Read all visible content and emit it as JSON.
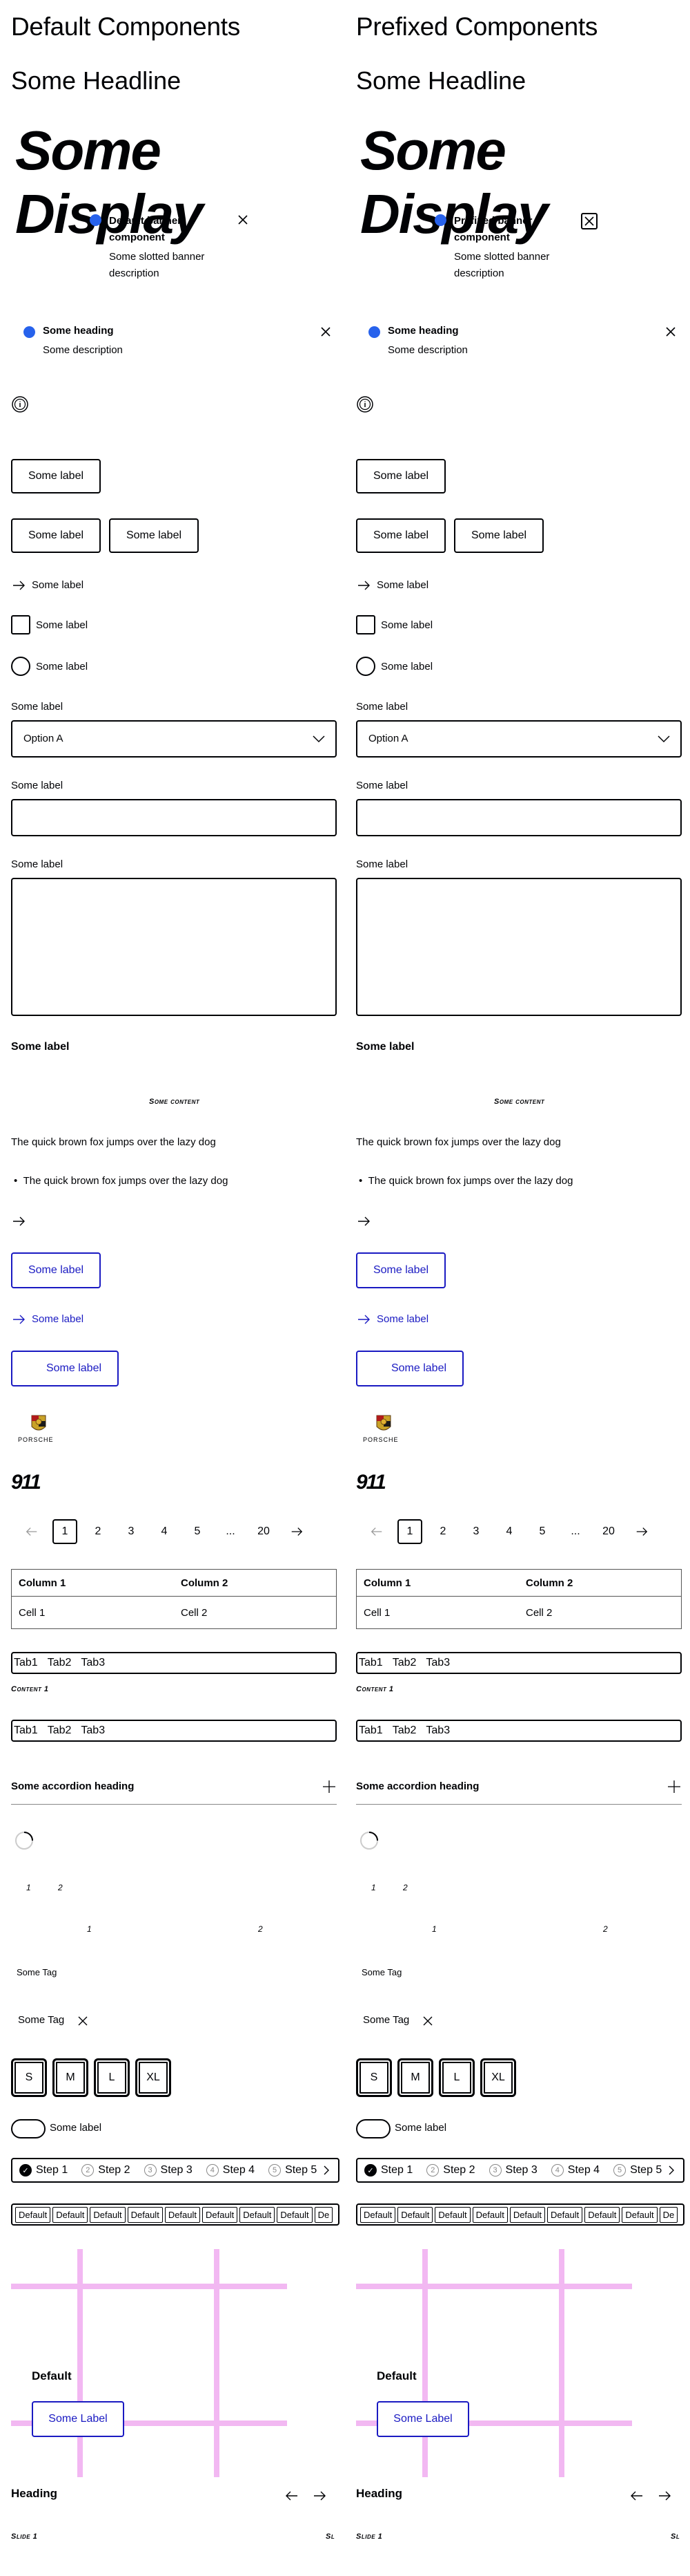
{
  "left": {
    "title": "Default Components",
    "headline": "Some Headline",
    "display": "Some Display",
    "banner": {
      "title": "Default banner component",
      "description": "Some slotted banner description"
    },
    "inline_notification": {
      "heading": "Some heading",
      "description": "Some description"
    },
    "button_label": "Some label",
    "button_group": [
      "Some label",
      "Some label"
    ],
    "link_pure_label": "Some label",
    "checkbox_label": "Some label",
    "radio_label": "Some label",
    "select": {
      "label": "Some label",
      "value": "Option A"
    },
    "text_field_label": "Some label",
    "textarea_label": "Some label",
    "text_heading": "Some label",
    "small_caps": "Some content",
    "text": "The quick brown fox jumps over the lazy dog",
    "list_item": "The quick brown fox jumps over the lazy dog",
    "link_label": "Some label",
    "link_pure_blue": "Some label",
    "link_social": "Some label",
    "crest_text": "PORSCHE",
    "model_signature": "911",
    "pagination": [
      "1",
      "2",
      "3",
      "4",
      "5",
      "...",
      "20"
    ],
    "table": {
      "headers": [
        "Column 1",
        "Column 2"
      ],
      "rows": [
        [
          "Cell 1",
          "Cell 2"
        ]
      ]
    },
    "tabs": [
      "Tab1",
      "Tab2",
      "Tab3"
    ],
    "tab_content": "Content 1",
    "tabs_bar": [
      "Tab1",
      "Tab2",
      "Tab3"
    ],
    "accordion_heading": "Some accordion heading",
    "grid_small": [
      "1",
      "2"
    ],
    "grid_wide": [
      "1",
      "2"
    ],
    "tag": "Some Tag",
    "tag_dismissible": "Some Tag",
    "sizes": [
      "S",
      "M",
      "L",
      "XL"
    ],
    "switch_label": "Some label",
    "steps": [
      "Step 1",
      "Step 2",
      "Step 3",
      "Step 4",
      "Step 5"
    ],
    "segments": [
      "Default",
      "Default",
      "Default",
      "Default",
      "Default",
      "Default",
      "Default",
      "Default",
      "De"
    ],
    "flyout_heading": "Default",
    "flyout_button": "Some Label",
    "carousel_heading": "Heading",
    "carousel_slide": "Slide 1",
    "carousel_next": "Sl"
  },
  "right": {
    "title": "Prefixed Components",
    "headline": "Some Headline",
    "display": "Some Display",
    "banner": {
      "title": "Prefixed banner component",
      "description": "Some slotted banner description"
    },
    "inline_notification": {
      "heading": "Some heading",
      "description": "Some description"
    },
    "button_label": "Some label",
    "button_group": [
      "Some label",
      "Some label"
    ],
    "link_pure_label": "Some label",
    "checkbox_label": "Some label",
    "radio_label": "Some label",
    "select": {
      "label": "Some label",
      "value": "Option A"
    },
    "text_field_label": "Some label",
    "textarea_label": "Some label",
    "text_heading": "Some label",
    "small_caps": "Some content",
    "text": "The quick brown fox jumps over the lazy dog",
    "list_item": "The quick brown fox jumps over the lazy dog",
    "link_label": "Some label",
    "link_pure_blue": "Some label",
    "link_social": "Some label",
    "crest_text": "PORSCHE",
    "model_signature": "911",
    "pagination": [
      "1",
      "2",
      "3",
      "4",
      "5",
      "...",
      "20"
    ],
    "table": {
      "headers": [
        "Column 1",
        "Column 2"
      ],
      "rows": [
        [
          "Cell 1",
          "Cell 2"
        ]
      ]
    },
    "tabs": [
      "Tab1",
      "Tab2",
      "Tab3"
    ],
    "tab_content": "Content 1",
    "tabs_bar": [
      "Tab1",
      "Tab2",
      "Tab3"
    ],
    "accordion_heading": "Some accordion heading",
    "grid_small": [
      "1",
      "2"
    ],
    "grid_wide": [
      "1",
      "2"
    ],
    "tag": "Some Tag",
    "tag_dismissible": "Some Tag",
    "sizes": [
      "S",
      "M",
      "L",
      "XL"
    ],
    "switch_label": "Some label",
    "steps": [
      "Step 1",
      "Step 2",
      "Step 3",
      "Step 4",
      "Step 5"
    ],
    "segments": [
      "Default",
      "Default",
      "Default",
      "Default",
      "Default",
      "Default",
      "Default",
      "Default",
      "De"
    ],
    "flyout_heading": "Default",
    "flyout_button": "Some Label",
    "carousel_heading": "Heading",
    "carousel_slide": "Slide 1",
    "carousel_next": "Sl"
  },
  "colors": {
    "accent_blue": "#2762ec",
    "link_blue": "#1a1ac2",
    "grid_pink": "#f2b8f2",
    "text": "#010205"
  }
}
